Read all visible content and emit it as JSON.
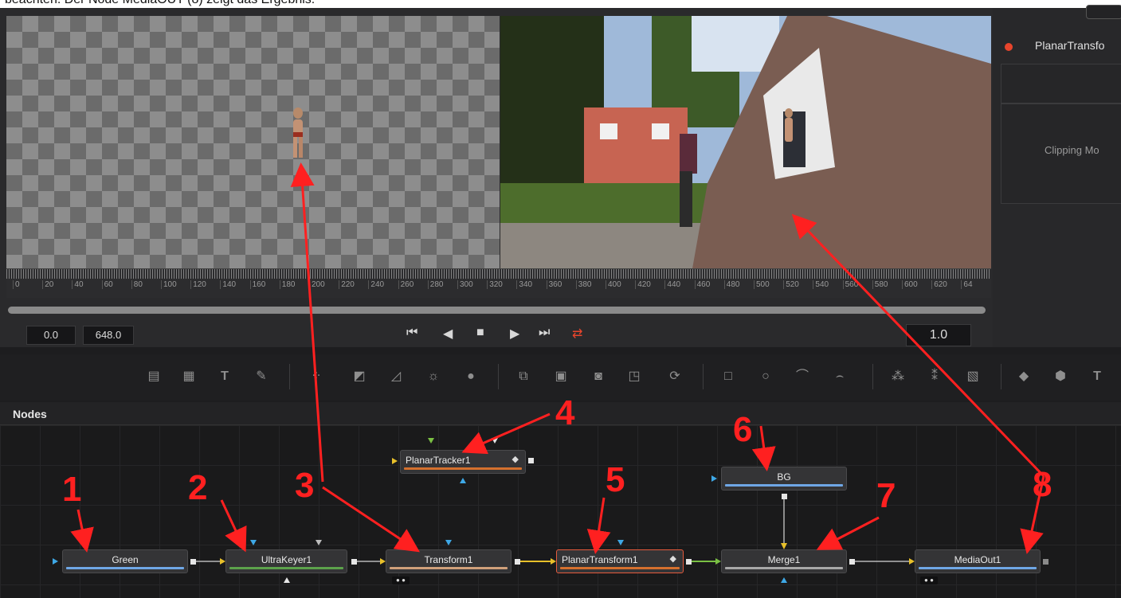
{
  "caption": {
    "text": "beachten. Der Node MediaOUT (8) zeigt das Ergebnis."
  },
  "ruler": {
    "ticks": [
      "0",
      "20",
      "40",
      "60",
      "80",
      "100",
      "120",
      "140",
      "160",
      "180",
      "200",
      "220",
      "240",
      "260",
      "280",
      "300",
      "320",
      "340",
      "360",
      "380",
      "400",
      "420",
      "440",
      "460",
      "480",
      "500",
      "520",
      "540",
      "560",
      "580",
      "600",
      "620",
      "64"
    ]
  },
  "time": {
    "start": "0.0",
    "end": "648.0",
    "speed": "1.0"
  },
  "transport": {
    "first": "⏮",
    "prev": "◀",
    "stop": "■",
    "play": "▶",
    "last": "⏭",
    "loop": "⇄"
  },
  "inspector": {
    "tool_label": "PlanarTransfo",
    "clipping_label": "Clipping Mo"
  },
  "nodes_panel": {
    "title": "Nodes"
  },
  "nodes": {
    "green": "Green",
    "ultrakeyer": "UltraKeyer1",
    "transform": "Transform1",
    "planartracker": "PlanarTracker1",
    "planartransform": "PlanarTransform1",
    "bg": "BG",
    "merge": "Merge1",
    "mediaout": "MediaOut1"
  },
  "annotations": [
    "1",
    "2",
    "3",
    "4",
    "5",
    "6",
    "7",
    "8"
  ],
  "colors": {
    "accent_red": "#ff2020",
    "link_yellow": "#e8c02a",
    "link_green": "#7ac043"
  }
}
